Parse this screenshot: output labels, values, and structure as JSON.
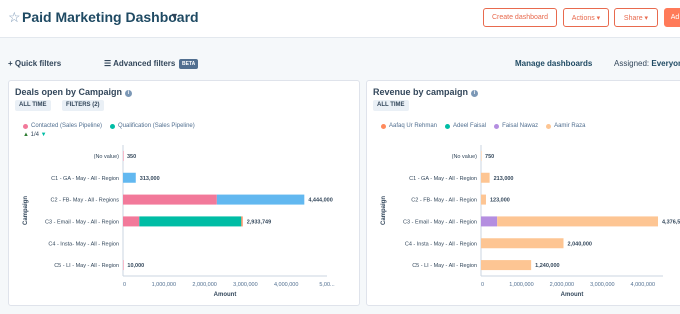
{
  "header": {
    "title": "Paid Marketing Dashboard",
    "create_label": "Create dashboard",
    "actions_label": "Actions ▾",
    "share_label": "Share ▾",
    "add_label": "Ad"
  },
  "filters": {
    "quick_label": "Quick filters",
    "advanced_label": "Advanced filters",
    "beta_label": "BETA",
    "manage_label": "Manage dashboards",
    "assigned_label": "Assigned:",
    "assigned_value": "Everyone"
  },
  "left_card": {
    "title": "Deals open by Campaign",
    "chip_time": "ALL TIME",
    "chip_filters": "FILTERS (2)",
    "pager": "1/4"
  },
  "right_card": {
    "title": "Revenue by campaign",
    "chip_time": "ALL TIME"
  },
  "chart_data": [
    {
      "type": "bar",
      "orientation": "horizontal",
      "stacked": true,
      "title": "Deals open by Campaign",
      "xlabel": "Amount",
      "ylabel": "Campaign",
      "xlim": [
        0,
        5000000
      ],
      "x_ticks": [
        "0",
        "1,000,000",
        "2,000,000",
        "3,000,000",
        "4,000,000",
        "5,00..."
      ],
      "categories": [
        "(No value)",
        "C1 - GA - May - All - Region",
        "C2 - FB- May - All - Regions",
        "C3 - Email - May - All - Region",
        "C4 - Insta- May - All - Region",
        "C5 - LI - May - All - Region"
      ],
      "totals": [
        "350",
        "313,000",
        "4,444,000",
        "2,933,749",
        "",
        "10,000"
      ],
      "series": [
        {
          "name": "Contacted (Sales Pipeline)",
          "color": "#f2799a",
          "values": [
            350,
            0,
            2300000,
            400000,
            0,
            10000
          ]
        },
        {
          "name": "Qualification (Sales Pipeline)",
          "color": "#00bda5",
          "values": [
            0,
            0,
            0,
            2500000,
            0,
            0
          ]
        },
        {
          "color": "#62b8f0",
          "values": [
            0,
            313000,
            2144000,
            0,
            0,
            0
          ]
        },
        {
          "color": "#ff8a5c",
          "values": [
            0,
            0,
            0,
            33749,
            0,
            0
          ]
        }
      ],
      "legend_position": "top-left"
    },
    {
      "type": "bar",
      "orientation": "horizontal",
      "stacked": true,
      "title": "Revenue by campaign",
      "xlabel": "Amount",
      "ylabel": "Campaign",
      "xlim": [
        0,
        4500000
      ],
      "x_ticks": [
        "0",
        "1,000,000",
        "2,000,000",
        "3,000,000",
        "4,000,000"
      ],
      "categories": [
        "(No value)",
        "C1 - GA - May - All - Region",
        "C2 - FB- May - All - Region",
        "C3 - Email - May - All - Region",
        "C4 - Insta - May - All - Region",
        "C5 - LI - May - All - Region"
      ],
      "totals": [
        "750",
        "213,000",
        "123,000",
        "4,376,50",
        "2,040,000",
        "1,240,000"
      ],
      "series": [
        {
          "name": "Aafaq Ur Rehman",
          "color": "#ff8a5c",
          "values": [
            0,
            0,
            0,
            0,
            0,
            0
          ]
        },
        {
          "name": "Adeel Faisal",
          "color": "#00bda5",
          "values": [
            0,
            0,
            0,
            0,
            0,
            0
          ]
        },
        {
          "name": "Faisal Nawaz",
          "color": "#b48ee0",
          "values": [
            0,
            0,
            0,
            400000,
            0,
            0
          ]
        },
        {
          "name": "Aamir Raza",
          "color": "#fdc593",
          "values": [
            750,
            213000,
            123000,
            3976500,
            2040000,
            1240000
          ]
        }
      ],
      "legend_position": "top-left"
    }
  ]
}
